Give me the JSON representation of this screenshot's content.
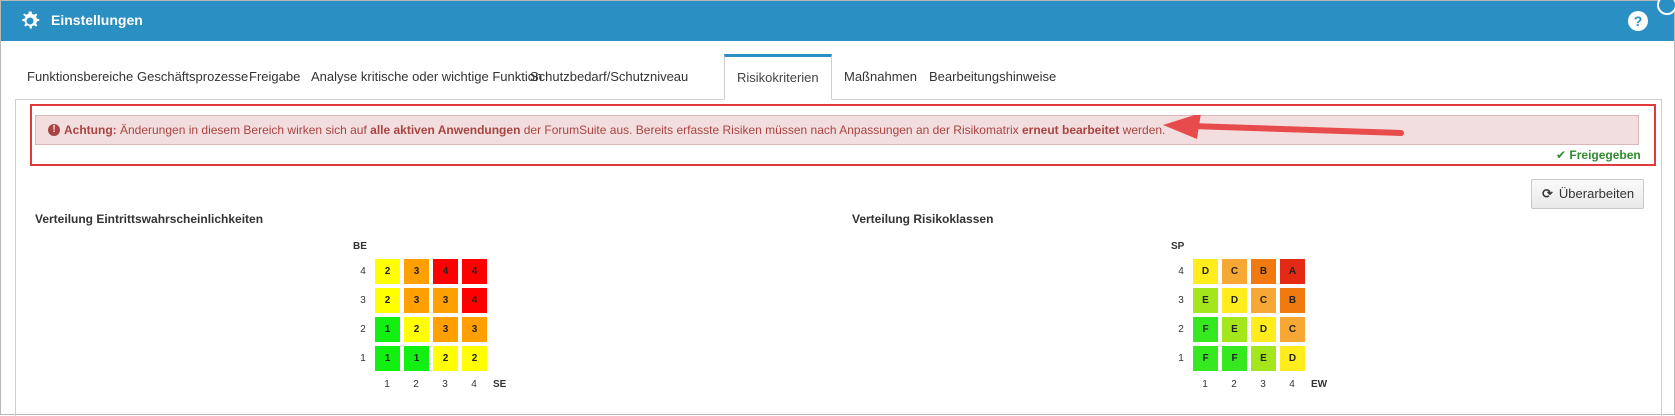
{
  "window": {
    "title": "Einstellungen",
    "help_label": "?",
    "icons": {
      "title": "gear-icon",
      "help": "help-icon"
    },
    "colors": {
      "titlebar": "#2a8fc3"
    }
  },
  "tabs": [
    {
      "label": "Funktionsbereiche",
      "active": false
    },
    {
      "label": "Geschäftsprozesse",
      "active": false
    },
    {
      "label": "Freigabe",
      "active": false
    },
    {
      "label": "Analyse kritische oder wichtige Funktion",
      "active": false
    },
    {
      "label": "Schutzbedarf/Schutzniveau",
      "active": false
    },
    {
      "label": "Risikokriterien",
      "active": true
    },
    {
      "label": "Maßnahmen",
      "active": false
    },
    {
      "label": "Bearbeitungshinweise",
      "active": false
    }
  ],
  "alert": {
    "icon": "!",
    "prefix": "Achtung:",
    "text1": " Änderungen in diesem Bereich wirken sich auf ",
    "bold1": "alle aktiven Anwendungen",
    "text2": " der ForumSuite aus. Bereits erfasste Risiken müssen nach Anpassungen an der Risikomatrix ",
    "bold2": "erneut bearbeitet",
    "text3": " werden.",
    "colors": {
      "background": "#f2dede",
      "text": "#a94442",
      "highlight_border": "#e23a3a"
    }
  },
  "status": {
    "icon": "✔",
    "label": "Freigegeben",
    "color": "#2e8b2e"
  },
  "edit_button": {
    "icon": "⟳",
    "label": "Überarbeiten"
  },
  "matrix_left": {
    "title": "Verteilung Eintrittswahrscheinlichkeiten",
    "y_axis": "BE",
    "x_axis": "SE",
    "row_labels": [
      "4",
      "3",
      "2",
      "1"
    ],
    "col_labels": [
      "1",
      "2",
      "3",
      "4"
    ],
    "rows": [
      [
        "2",
        "3",
        "4",
        "4"
      ],
      [
        "2",
        "3",
        "3",
        "4"
      ],
      [
        "1",
        "2",
        "3",
        "3"
      ],
      [
        "1",
        "1",
        "2",
        "2"
      ]
    ]
  },
  "matrix_right": {
    "title": "Verteilung Risikoklassen",
    "y_axis": "SP",
    "x_axis": "EW",
    "row_labels": [
      "4",
      "3",
      "2",
      "1"
    ],
    "col_labels": [
      "1",
      "2",
      "3",
      "4"
    ],
    "rows": [
      [
        "D",
        "C",
        "B",
        "A"
      ],
      [
        "E",
        "D",
        "C",
        "B"
      ],
      [
        "F",
        "E",
        "D",
        "C"
      ],
      [
        "F",
        "F",
        "E",
        "D"
      ]
    ]
  },
  "cell_colors": {
    "1": "#11f010",
    "2": "#ffff00",
    "3": "#ff9f00",
    "4": "#fe0000",
    "A": "#e42a14",
    "B": "#f07a10",
    "C": "#f7a733",
    "D": "#ffec1d",
    "E": "#a4e61c",
    "F": "#35e81f"
  }
}
